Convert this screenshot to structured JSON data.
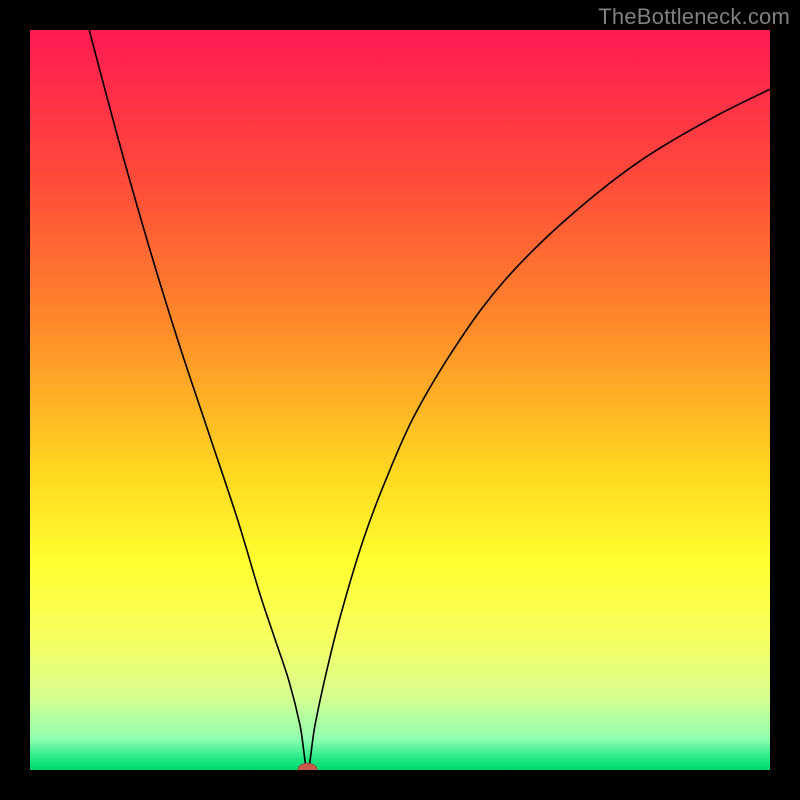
{
  "watermark": {
    "text": "TheBottleneck.com"
  },
  "colors": {
    "frame": "#000000",
    "watermark": "#808080",
    "curve": "#000000",
    "marker_fill": "#c85a4a",
    "marker_stroke": "#a04438",
    "gradient_stops": [
      {
        "offset": 0.0,
        "color": "#ff1a52"
      },
      {
        "offset": 0.2,
        "color": "#ff4a3a"
      },
      {
        "offset": 0.4,
        "color": "#ff8a2a"
      },
      {
        "offset": 0.6,
        "color": "#ffd820"
      },
      {
        "offset": 0.72,
        "color": "#ffff30"
      },
      {
        "offset": 0.82,
        "color": "#f7ff60"
      },
      {
        "offset": 0.9,
        "color": "#d8ff90"
      },
      {
        "offset": 0.958,
        "color": "#90ffb0"
      },
      {
        "offset": 0.985,
        "color": "#20e883"
      },
      {
        "offset": 1.0,
        "color": "#00d870"
      }
    ]
  },
  "chart_data": {
    "type": "line",
    "title": "",
    "xlabel": "",
    "ylabel": "",
    "xlim": [
      0,
      100
    ],
    "ylim": [
      0,
      100
    ],
    "grid": false,
    "legend": false,
    "notch": {
      "x": 37.5,
      "y": 0
    },
    "series": [
      {
        "name": "curve",
        "x": [
          8,
          12,
          16,
          20,
          24,
          28,
          31,
          33,
          35,
          36.5,
          37.5,
          38.5,
          40,
          42,
          45,
          48,
          52,
          58,
          64,
          72,
          82,
          92,
          100
        ],
        "y": [
          100,
          85,
          71,
          58,
          46,
          34,
          24,
          18,
          12,
          6,
          0,
          6,
          13,
          21,
          31,
          39,
          48,
          58,
          66,
          74,
          82,
          88,
          92
        ]
      }
    ],
    "marker": {
      "x": 37.5,
      "y": 0,
      "rx": 1.3,
      "ry": 0.9
    }
  }
}
